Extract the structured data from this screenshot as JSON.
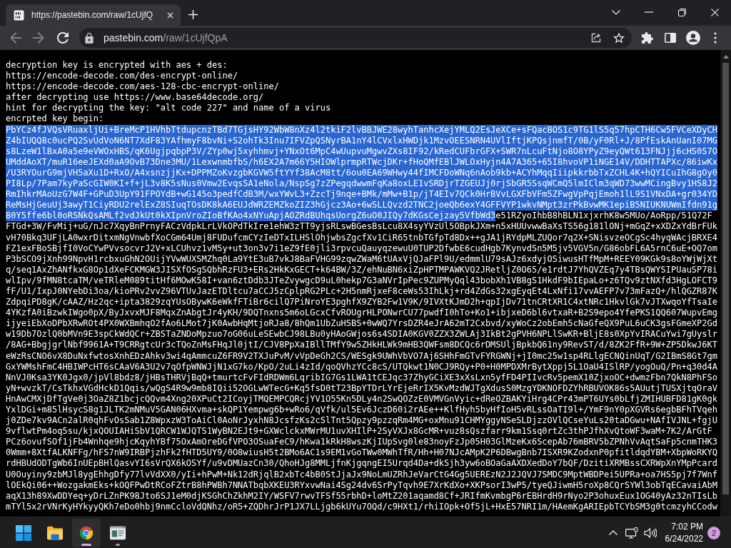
{
  "browser": {
    "tabs": [
      {
        "title": "https://pastebin.com/raw/1cUjfQ",
        "selected": true
      }
    ],
    "toolbar": {
      "back": {
        "disabled": true
      },
      "forward": {
        "disabled": true
      },
      "address": {
        "host": "pastebin.com",
        "path": "/raw/1cUjfQpA"
      }
    }
  },
  "page": {
    "intro_lines": [
      "decryption key is encrypted with aes + des:",
      "https://encode-decode.com/des-encrypt-online/",
      "https://encode-decode.com/aes-128-cbc-encrypt-online/",
      "after decrypting use https://www.base64decode.org/",
      "hint for decrypting the key: \"alt code 227\" and name of a virus",
      "encrpted key begin:"
    ],
    "key_lines": [
      {
        "segments": [
          {
            "text": "PbYCz4fJVQsVRuaxljUi+BreMcP1HVhbTtdupcnzTBd7TGjsHY92WbW8nXz4l2tkiF2lvBBJWE28wyhTanhcXejYMLQ2EsJeXCe+sFQacBOS1c9TG1lS5q57hpCTH6Cw5FVCeXDyCH",
            "selected": true
          }
        ]
      },
      {
        "segments": [
          {
            "text": "Z4bIUQQ8c0ucPQ2SvUdVoN6NT7XdF83YAfhmyF8bvNi+S2ohTk3Inu7IFVZpQSNyrBA1nY4lCVxlxHWDjk1MzvOEESNRN4UVlIftjKPQsjnmfT/0B/yF0Rl+J/8PfEskAnUanI07MG",
            "selected": true
          }
        ]
      },
      {
        "segments": [
          {
            "text": "s8LzeW1lBxA0a5e9eVWOxHBS/qK6UgjpqbpP3V/ZYp0wj5xyhhmvj+YNxOt6MpC4wUupvuMgwvZXs8IF92/kRedCUFbrGFX+SWR7nLcuFtNjo8O8YPyZ9eyQWt613FNJjj6cHS0S7O",
            "selected": true
          }
        ]
      },
      {
        "segments": [
          {
            "text": "UMddAoXT/muR16eeJEXd0aA9OvB73Dne3MU/1LexwnmbfbS/h6EX2A7m66Y5HIOWlprmpRTWcjDKr+fHoQMfEBlJWLOxHyjn4A7A365+65I8hvoVP1iNGE14V/DDHTTAPXc/86iwKx",
            "selected": true
          }
        ]
      },
      {
        "segments": [
          {
            "text": "/U3RYOurG9mjVH5aXu1D+RxO/A4xsnzjjKx+DPPMZoKvzgbKGVW5ftYYf38AcM8tt/6ou0EA69WHwy44fIMCFDoWNq6nAob9kb+ACYhMqqIiipkkrbbTxZCHL4K+hQYICuIhG8gOy0",
            "selected": true
          }
        ]
      },
      {
        "segments": [
          {
            "text": "PI8Lp/7Pam7kyPaScGIW0KI+f+jL3v8K5sNus0Vmw2EvqsSA1eNola/NspSg7zZPegqdwwmFqKa8oxLE1vSRDjrTZGEUJj0rjSbGR5SsqWCmQ5lmIClm3qWD73wwMCingBvy1HS8J2",
            "selected": true
          }
        ]
      },
      {
        "segments": [
          {
            "text": "RmIhkrMAoUzG7W4F+GPuD3UpY91FPOYdB+wG145o3pedfCdB3M/wxYWvL3+ZzcTj9nqe+BMk/mMw+B1p/jT4EIv7QCk0HrBVvLGXFbVFm5ZFwgVpPqjEmoh1lL9S1VNxDA+gr034YD",
            "selected": true
          }
        ]
      },
      {
        "segments": [
          {
            "text": "ReMsHjGeuUj3awyT1CiyRDU2relExZ8SIuqTOsDK8kA6EUJdWRZEMZkoZIZ3hGjcz3Ao+6wSLLQvzd2TNC2joeQb6exY4GFFVYP1wkvNMpt3zrPkBvwMK1epiB5NIUKNUWmIfdn91g",
            "selected": true
          }
        ]
      },
      {
        "segments": [
          {
            "text": "B0Y5ffe6bl0oRSNkQsAMLf2vdJkUt0kXIpnVroZIoBfKAo4xNYuApjAOZRdBUhqsUorgZ6uO0JIQy7dKGsCejzay5VfbWd3",
            "selected": true
          },
          {
            "text": "e51RZyoIhbB8hBLN1xjxrhK8w5MUo/AoRpp/51Q72F",
            "selected": false
          }
        ]
      },
      {
        "segments": [
          {
            "text": "FTGd+3W/FvMij+uG/nJc7XqyBnPrnyFACzVdpkLrLVkOPdTkIre1ehW3zTT9yjsRLswBGesBsLcu8X4syYVzUl5OBpkJXm+n5xHUUvwwBaXsTS56g181lONj+mGqZ+xXDZxYdBrFUk",
            "selected": false
          }
        ]
      },
      {
        "segments": [
          {
            "text": "vH70Bkq3UFjLA0wxrDitxmNgVnwbfXoCGm64Umj8FUDufcmCYzIeDTxILHSlOhjwbsZgcfXv1CiR65tnbTGfpTd8Dx++gJA1jRYdpMLZUQor7q2X+SNisvzeOCgSc4hyqWAcjBRXE4",
            "selected": false
          }
        ]
      },
      {
        "segments": [
          {
            "text": "FZ1exFBoSBjfI0VoCYwPVvsocvrJ2V+xLCUhvz1vM5y+ut3on3v7i1eZ9fE0jli3rpvcuQauyqzewuU0TUP2DfwbE6cudHgb7KynvdSn5M5jv5VGV5n/G86obFL6A5rnC6uE+OQ7om",
            "selected": false
          }
        ]
      },
      {
        "segments": [
          {
            "text": "P3bSCO9jXnh99NpvH1rcbxuGhN2OUijYVwWUXSMZhq0La9YtE3uB7vkJ8BaFVHG99zqwZWaM6tUAxVjQJaFPl9U/edmmlU79sAJz6xdyjOSiwusHTfMpM+REEY09KGk9s8oYWjWjXt",
            "selected": false
          }
        ]
      },
      {
        "segments": [
          {
            "text": "q/seq1AxZhANfkxG8Op1dXeFCKMGW3JISXfOSgSQbhRzFU3+ERs2HkKxGECT+k64BW/3Z/ehNuBN6xiZpHPTMPAWKVQ2JRetljZ0O65/e1rdtJ7YhQVZEq7y4TBsQWYSIPUauSP78i",
            "selected": false
          }
        ]
      },
      {
        "segments": [
          {
            "text": "wlIpv/9fMN8tcaTM/veTRleM089titHf6MOwK58I+van6ztDdb3JTeZvywgcD9uL0hekp7G3aNVrIpPec9ZUPMyQql43bobXh1VB8gS1HkdF9bIEpaLo+z6TQv9ztNXfd3HgLOFCT9",
            "selected": false
          }
        ]
      },
      {
        "segments": [
          {
            "text": "fF/U1/IxpJ0NYebDi3oa/kioPRv2vvZ96VTUvJazETDltcu7aCCJ5zCplpRG2PLc+2H5nmRjxeF8ceWs53IhLkj+rd4ZdGs32xgEyqEt4LxNfi17vvAEFP7v73mFazQ+/hlQGZR87K",
            "selected": false
          }
        ]
      },
      {
        "segments": [
          {
            "text": "ZdpqiPD8gK/cAAZ/Hz2qc+ipta3829zqYUsOBywK6eWkfFTiBr6cilQ7PiNroYE3pghfX9ZYB2Fw1V9K/9IVXtKJmD2h+qpIjDv71tnCRtXR1C4xtNRc1HkvlGk7vJTXwqoYfTsaIe",
            "selected": false
          }
        ]
      },
      {
        "segments": [
          {
            "text": "4YKzfA0iBzwkIWgo0pX/ByJxvxMJF8MqxZnAbgtJr4yKH/9DQTnxns5m6oLGcxCfvROUgrHLPONwrCU77pwdfI0hTo+Ko1+ibjxeD6bl6vtxaR+B2S9epo4YfePKS1QQ607WupvEmg",
            "selected": false
          }
        ]
      },
      {
        "segments": [
          {
            "text": "ijyeiEbXoDPbXRwROt4PX0WXBmhqO2fAo6LMot7jK0AwbHqMtjoRJa8/8hQm1UbZuHSBS+0wWQ7YrsDZR4eJrA62mT2Cxbvd/xyWoCz2obEmh5cNaGfeQX9PuL6uCK3gsFGmeXP2Gd",
            "selected": false
          }
        ]
      },
      {
        "segments": [
          {
            "text": "w19Db7OzlQ0bMVn9E3spCkWdQCr+ZBSTaZNDoMpzuo7oG06uLeSEwbCJ98LBu0yHAoGWjos6s4SDIA0KGV0ZZX3ZWLAj3IkBt2gPVH6NPLlSwKR+BljE8s0XpYvIRACuYwi7gUyslr",
            "selected": false
          }
        ]
      },
      {
        "segments": [
          {
            "text": "/8AG+BbgjgrlNbf9961A+T9CRRgtcUr3cTQoZnMsFHqJl0jtI/CJV8PpXaIBllTMfY9w5ZHkHLWk9mHB3QWFsm8DCQc6rDMSUljBpkbQ61ny9RevST/d/8ZK2FfR+9W+ZP5DkwJ6KT",
            "selected": false
          }
        ]
      },
      {
        "segments": [
          {
            "text": "eWzRsCNO6vX8DuNxfwtosXnhEDzAhkv3wi4qAmmcuZ6FR9V2TXJuPvM/vVpDeGh2CS/WESgk9UWhVbVO7Aj6SHhFmGTvFYRGWNj+jI0mc25w1sp4RLlgECNQinUqT/G2IBmS8Gt7gm",
            "selected": false
          }
        ]
      },
      {
        "segments": [
          {
            "text": "GxYWMshFmC4HBIWPcHT6sCAaV6A3U2v7qOfpWNWJjN1xG7ko/KpO/2uLi4zId/qoQVhzYCc8cS/UTQkwt1N0CJ9RQy+P0+H0MPDXMrBytXppj5L1OaU4ISlRP/yogOuQ/Pn+q30d4A",
            "selected": false
          }
        ]
      },
      {
        "segments": [
          {
            "text": "NnVJ0Ksa3YK0Jgx0/jpVl8bdz8/jHBsTHRVjBqQ+tmurtcFvFIdRDWm6LqribIG7Gs1LWA1tCEJqc37ZhyGCiXE3xXsLxn5yfFD4PIIvcRv5pemX10ZjxoOC+dwmzFbn7QkN8PhFSo",
            "selected": false
          }
        ]
      },
      {
        "segments": [
          {
            "text": "yN+wvzkT/CsTkhxVGdHckD1Qqis/wQgS4R9w9mb8IQii52OGLwWTecG+Kq5fsD0tT23BpYTDrLYrEjeRrIX5KvMzdWJTgXdusS0MzgYDKNOFDZYhRBUVOK86s5AUutjTUSXjtqOraV",
            "selected": false
          }
        ]
      },
      {
        "segments": [
          {
            "text": "HnAwCMXjDfTgVe0j3OaZ8Z1bcjcQQvm4Xng20XPuCt2ICoyjTMQEMPCQRcjYV1O55Kn5DLy4n2SwQOZzE0VMVGnVyic+dReOZBAKYiHrg4CPr43mPT6UYs0bLfjZMIHUBFD81gK0gk",
            "selected": false
          }
        ]
      },
      {
        "segments": [
          {
            "text": "YxlDGi+m85lHsycS8g1JLTK2mNMuV5GAN06HXvma+skQP1Yempwg6b+wRo6/qVfk/ul5Ev6JczD60i2rAEe++KlfHyh5byHfIoH5vRLssOaTI9l+/YmF9nY0pXGVRs6egbBFhTVqeh",
            "selected": false
          }
        ]
      },
      {
        "segments": [
          {
            "text": "j0ZDe7kv9ACn2alR0qhFvOsSab1Z8WpxzW3ToAiCl0AoNrJyxhN8JcsfzKs2cSlTnt5Qpzy9pzzqRm4MG+oxMnu91CHMYggyNSeSLDjzzOVlQCseYuLs20taDGwu+NAfIVJNL+fgjU",
            "selected": false
          }
        ]
      },
      {
        "segments": [
          {
            "text": "9vflwtPm4oq5su/kjxQOUIAHiSbV1QRCW1WJQTS1WyBN2EJt9+GXWclckxMWrMU1uvXHIlP+2SyVXJx8GcMR+vuz8sQszfarr9km1Ssq0rtZc3thPJfhXvQtoWF3waM+7K2/ArGtF",
            "selected": false
          }
        ]
      },
      {
        "segments": [
          {
            "text": "PCz6ovufSOf1jFb4Wnhqe9hjcKqyhYBf75OxAmOreDGfVPO3OSuaFeC9/hKwa1kRkH8wszKjIUpSvg0le83noyFzJp05H03GlMzeKx6ScepAb76mBRV5bZPNhVvAqtSaFp5cnmTHK3",
            "selected": false
          }
        ]
      },
      {
        "segments": [
          {
            "text": "0Wmm+8XtfALKNFFg/hFS7nW9IRBPjzhFk2fHTD5UY9/0O8wiusH5t2BMo6AC1s9EM1vGoTWw0MWhTfR/Hh+H07NJcAMpK2P6DBwgBnb7ISXR9KZodxnP0pfitldqdYBM+XbpWoRKYQ",
            "selected": false
          }
        ]
      },
      {
        "segments": [
          {
            "text": "rdHBUdODTgWb6InUEpBHlQasvYI6sVrQX6kOSYf/u9vDMUazCn30/QhoHJg8MMLjfnKjgqngEI5Urqd4Da+dkSjh3yw6oBOaGaAXDXedDoY7bQF/DzitiXRMBssCXRWpXnYMpPcard",
            "selected": false
          }
        ]
      },
      {
        "segments": [
          {
            "text": "U0Ouyiny9zbMJl8ygEhhgDfy77lvVdXX0/yIi+hPwM+Nk12dRjqlB2xbTc4bB0StJjaJx9NoLmUZRhJeVarCtG4Gg5UEREzN2J2JQVJ7SMDC9MptWBDPei5UPRa+oa7HS5pj7f7Wnf",
            "selected": false
          }
        ]
      },
      {
        "segments": [
          {
            "text": "lOEkQi06++WozgakmEks+kOQFPwDtRCoFZtrB8hPWBh7NNATbqbXKEU3RYxvwNai4Sg24dv6SrPyTqvh9E7XrKdXo+XKPsorI3wP5/tyeQJiwmH5roXp8CQrSYWl3obTqECavaiAbM",
            "selected": false
          }
        ]
      },
      {
        "segments": [
          {
            "text": "aqX13h89XwDDYeq+yDrLZnPK98Jto6SJ1eM0djKSGhChZkhM2IY/WSFV7rwvTFSf55rbhD+loMtZ201aqamd8Cf+JRIfmKvmbgP6rEBHrdH9rNyo2P3ohuxEux1OG40yAz32nTIsLb",
            "selected": false
          }
        ]
      },
      {
        "segments": [
          {
            "text": "mTYl5x2rVNrKyHYkyyQKh7eDo0hbj9nmCcloVdQNhz/oR5+ZQDhrJrP1JX7LLjgb6kUYu7OQd/c9HXt1/rhiIOpk+Of5jL+HxE57NRI1m/HAemKgARIEpbTCYbSM3g0tcmzyhCCodw",
            "selected": false
          }
        ]
      }
    ]
  },
  "taskbar": {
    "apps": [
      {
        "kind": "folder",
        "selected": false,
        "running": false
      },
      {
        "kind": "browser",
        "selected": true,
        "running": true
      },
      {
        "kind": "viewer",
        "selected": false,
        "running": true
      }
    ],
    "time": "7:02 PM",
    "date": "6/24/2022",
    "notifications": "2"
  }
}
